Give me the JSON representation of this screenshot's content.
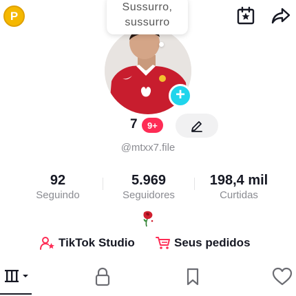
{
  "top_bar": {
    "coin_letter": "P",
    "coin_icon": "coin-icon",
    "calendar_icon": "calendar-star-icon",
    "share_icon": "share-arrow-icon"
  },
  "note": {
    "line1": "Sussurro,",
    "line2": "sussurro"
  },
  "profile": {
    "name": "7",
    "badge": "9+",
    "handle": "@mtxx7.file",
    "edit_icon": "pencil-icon",
    "add_icon": "plus-icon"
  },
  "stats": [
    {
      "value": "92",
      "label": "Seguindo"
    },
    {
      "value": "5.969",
      "label": "Seguidores"
    },
    {
      "value": "198,4 mil",
      "label": "Curtidas"
    }
  ],
  "bio_icon": "rose-icon",
  "links": {
    "studio": "TikTok Studio",
    "orders": "Seus pedidos"
  },
  "tabs": [
    "videos-grid-icon",
    "lock-icon",
    "bookmark-icon",
    "heart-icon"
  ],
  "colors": {
    "accent": "#fe2c55",
    "add_button": "#20d5ec",
    "coin": "#f5b800"
  }
}
